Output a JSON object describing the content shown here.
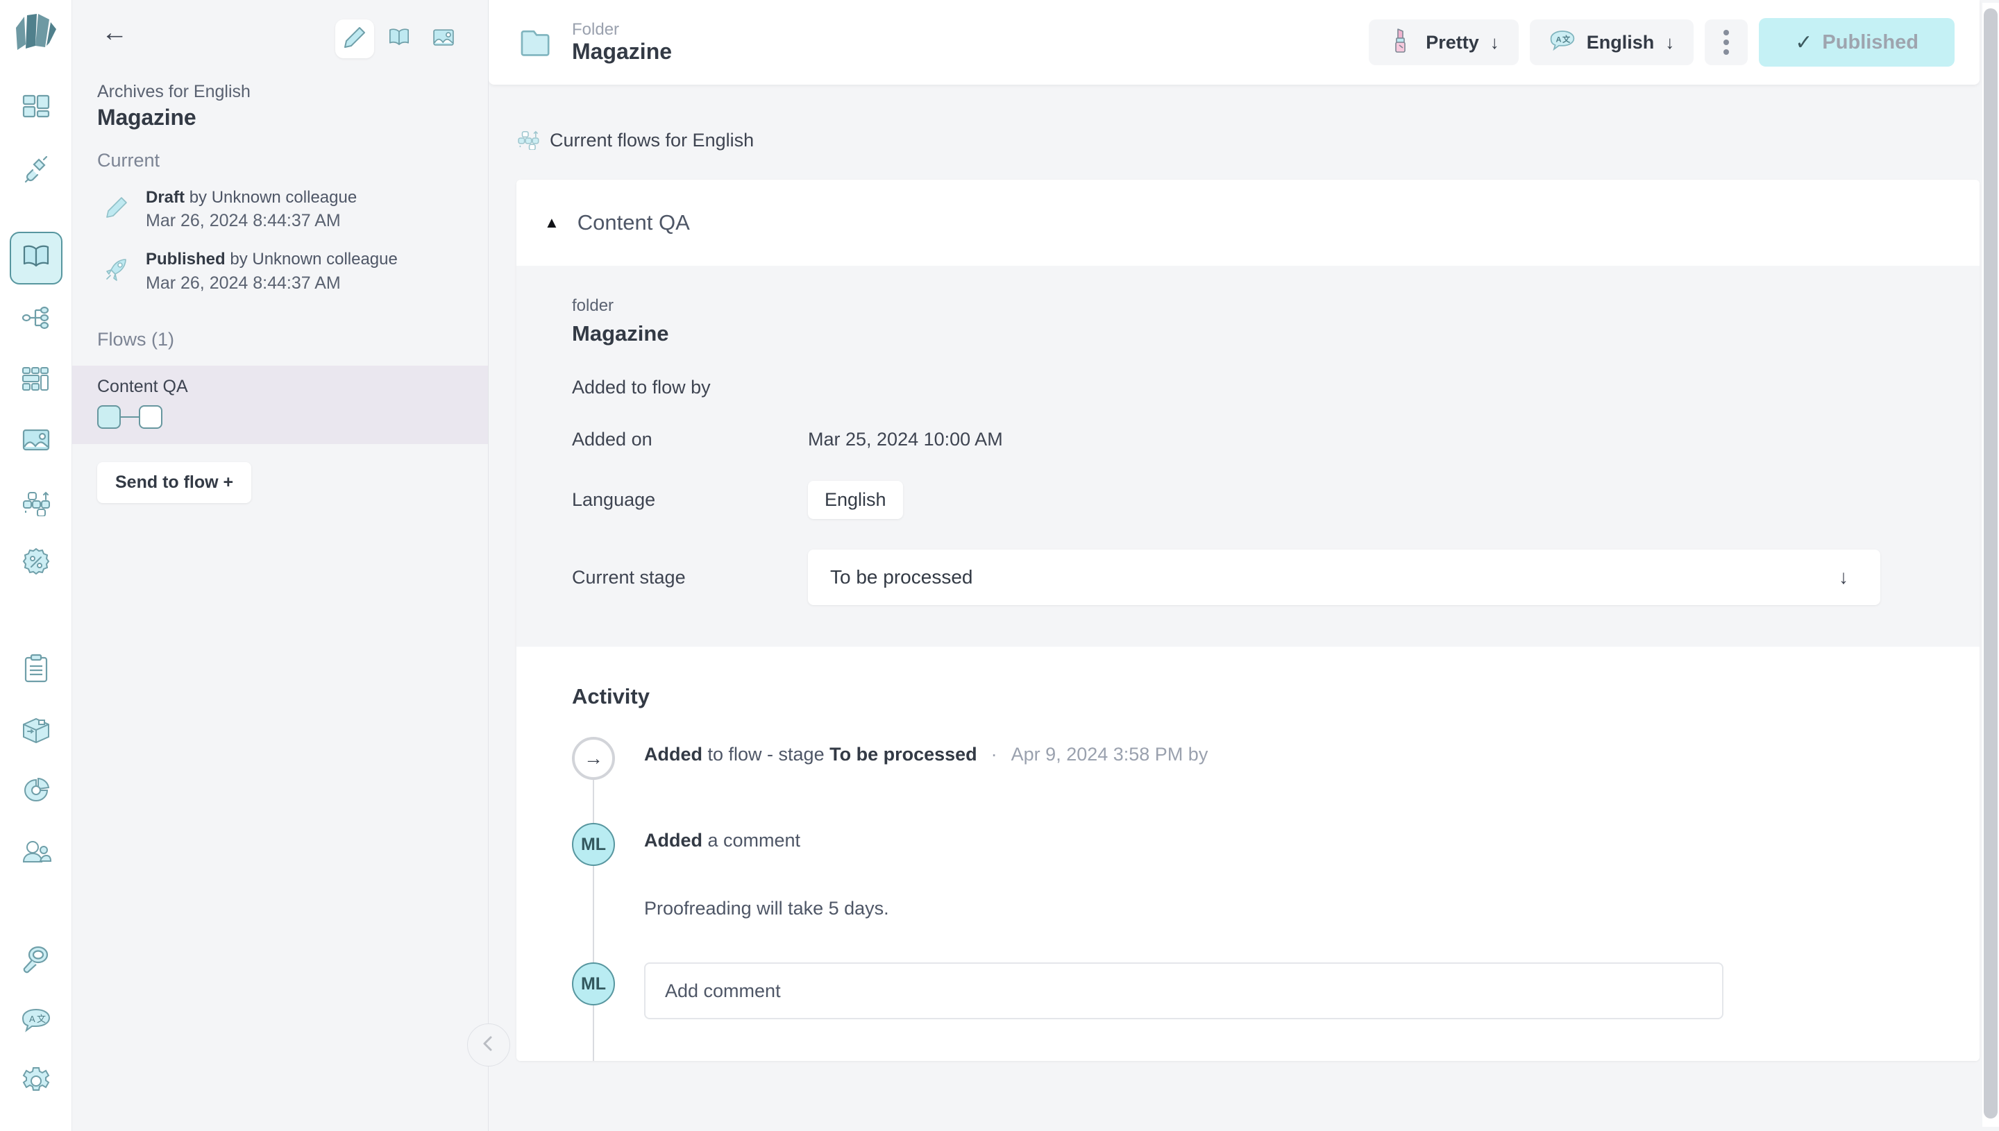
{
  "rail": {
    "logo": "book-pages-logo",
    "items": [
      {
        "name": "dashboard",
        "icon": "layout-grid-icon",
        "active": false
      },
      {
        "name": "integrations",
        "icon": "plug-connect-icon",
        "active": false
      },
      {
        "name": "library",
        "icon": "open-book-icon",
        "active": true
      },
      {
        "name": "taxonomy",
        "icon": "hierarchy-nodes-icon",
        "active": false
      },
      {
        "name": "components",
        "icon": "blocks-layout-icon",
        "active": false
      },
      {
        "name": "media",
        "icon": "image-picture-icon",
        "active": false
      },
      {
        "name": "flows",
        "icon": "flow-diagram-icon",
        "active": false
      },
      {
        "name": "promotions",
        "icon": "percent-badge-icon",
        "active": false
      },
      {
        "name": "tasks",
        "icon": "clipboard-list-icon",
        "active": false
      },
      {
        "name": "products",
        "icon": "box-package-icon",
        "active": false
      },
      {
        "name": "analytics",
        "icon": "donut-chart-icon",
        "active": false
      },
      {
        "name": "users",
        "icon": "people-group-icon",
        "active": false
      },
      {
        "name": "search",
        "icon": "magnifier-icon",
        "active": false
      },
      {
        "name": "translations",
        "icon": "translate-bubble-icon",
        "active": false
      },
      {
        "name": "settings",
        "icon": "gear-icon",
        "active": false
      }
    ]
  },
  "panel": {
    "back_icon": "back-arrow-icon",
    "tools": [
      {
        "name": "edit",
        "icon": "pencil-icon",
        "selected": true
      },
      {
        "name": "preview",
        "icon": "open-book-icon",
        "selected": false
      },
      {
        "name": "media",
        "icon": "image-picture-icon",
        "selected": false
      }
    ],
    "subtitle": "Archives for English",
    "title": "Magazine",
    "section_label": "Current",
    "revisions": [
      {
        "icon": "pencil-icon",
        "status": "Draft",
        "by": "by Unknown colleague",
        "timestamp": "Mar 26, 2024 8:44:37 AM"
      },
      {
        "icon": "rocket-icon",
        "status": "Published",
        "by": "by Unknown colleague",
        "timestamp": "Mar 26, 2024 8:44:37 AM"
      }
    ],
    "flows_header": "Flows (1)",
    "flows": [
      {
        "name": "Content QA",
        "stages": [
          "done",
          "todo"
        ],
        "selected": true
      }
    ],
    "send_to_flow_label": "Send to flow +",
    "collapse_icon": "chevron-left-icon"
  },
  "topbar": {
    "folder_icon": "folder-icon",
    "kicker": "Folder",
    "title": "Magazine",
    "theme_pill": {
      "icon": "lipstick-icon",
      "label": "Pretty",
      "caret": "↓"
    },
    "language_pill": {
      "icon": "translate-bubble-icon",
      "label": "English",
      "caret": "↓"
    },
    "kebab_name": "more-options-icon",
    "publish_button": {
      "check": "✓",
      "label": "Published"
    }
  },
  "main": {
    "flows_label": "Current flows for English",
    "flows_label_icon": "flow-diagram-icon",
    "flow_card": {
      "collapse_triangle": "▲",
      "title": "Content QA",
      "detail": {
        "kicker": "folder",
        "title": "Magazine",
        "rows": [
          {
            "label": "Added to flow by",
            "value": "",
            "type": "text"
          },
          {
            "label": "Added on",
            "value": "Mar 25, 2024 10:00 AM",
            "type": "text"
          },
          {
            "label": "Language",
            "value": "English",
            "type": "chip"
          },
          {
            "label": "Current stage",
            "value": "To be processed",
            "type": "select",
            "caret": "↓"
          }
        ]
      }
    },
    "activity": {
      "title": "Activity",
      "entries": [
        {
          "avatar_type": "ring",
          "avatar_icon": "arrow-right-icon",
          "avatar_text": "→",
          "bold_prefix": "Added",
          "text": " to flow - stage ",
          "bold_suffix": "To be processed",
          "separator": "·",
          "timestamp": "Apr 9, 2024 3:58 PM by"
        },
        {
          "avatar_type": "avatar",
          "avatar_text": "ML",
          "bold_prefix": "Added",
          "text": " a comment",
          "bold_suffix": "",
          "separator": "",
          "timestamp": "",
          "comment": "Proofreading will take 5 days."
        }
      ],
      "composer": {
        "avatar_text": "ML",
        "placeholder": "Add comment"
      }
    }
  }
}
